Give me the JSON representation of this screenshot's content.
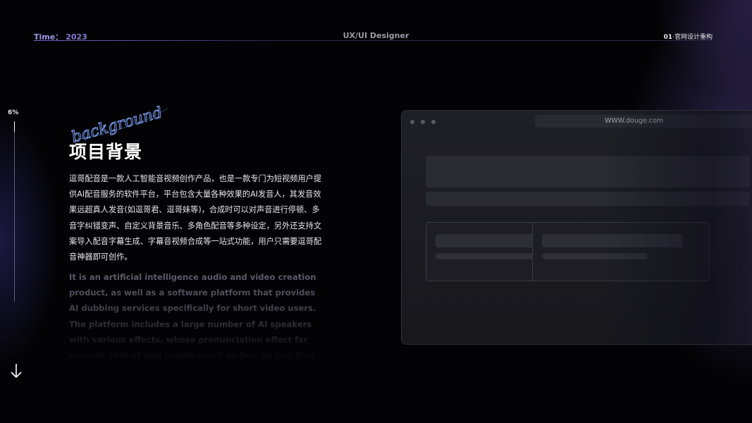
{
  "header": {
    "time_label": "Time：",
    "time_value": "2023",
    "role": "UX/UI Designer",
    "project_number": "01",
    "project_name": "·官网设计重构"
  },
  "progress": {
    "label": "6%",
    "value_percent": 6
  },
  "section": {
    "script_word": "background",
    "title": "项目背景",
    "description_cn": "逗哥配音是一款人工智能音视频创作产品，也是一款专门为短视频用户提供AI配音服务的软件平台，平台包含大量各种效果的AI发音人，其发音效果远超真人发音(如逗哥君、逗哥妹等)，合成时可以对声音进行停顿、多音字纠错变声、自定义背景音乐、多角色配音等多种设定，另外还支持文案导入配音字幕生成、字幕音视频合成等一站式功能，用户只需要逗哥配音神器即可创作。",
    "description_en": "It is an artificial intelligence audio and video creation product, as well as a software platform that provides AI dubbing services specifically for short video users. The platform includes a large number of AI speakers with various effects, whose pronunciation effect far exceeds that of real people (such as Dou Ge Jun, Dou Ge Mei, etc.). When synthesizing, it can pause the sound, correct polyphonic errors,"
  },
  "browser": {
    "url": "WWW.douge.com"
  },
  "icons": {
    "scroll": "arrow-down-icon"
  },
  "colors": {
    "accent": "#8e86e0",
    "script": "#7ea6ff",
    "background": "#030305"
  }
}
